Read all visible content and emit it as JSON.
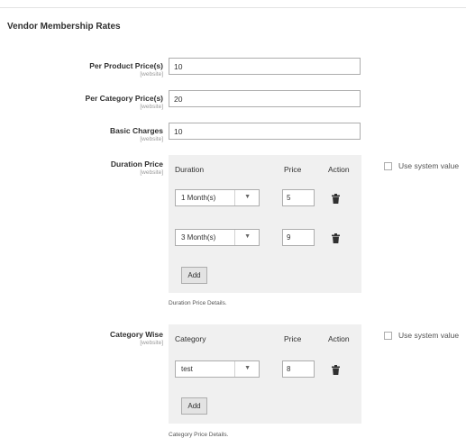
{
  "section_title": "Vendor Membership Rates",
  "scope_label": "[website]",
  "fields": {
    "per_product": {
      "label": "Per Product Price(s)",
      "value": "10"
    },
    "per_category": {
      "label": "Per Category Price(s)",
      "value": "20"
    },
    "basic_charges": {
      "label": "Basic Charges",
      "value": "10"
    }
  },
  "duration_price": {
    "label": "Duration Price",
    "headers": {
      "col1": "Duration",
      "col2": "Price",
      "col3": "Action"
    },
    "rows": [
      {
        "duration": "1 Month(s)",
        "price": "5"
      },
      {
        "duration": "3 Month(s)",
        "price": "9"
      }
    ],
    "add_label": "Add",
    "note": "Duration Price Details."
  },
  "category_wise": {
    "label": "Category Wise",
    "headers": {
      "col1": "Category",
      "col2": "Price",
      "col3": "Action"
    },
    "rows": [
      {
        "category": "test",
        "price": "8"
      }
    ],
    "add_label": "Add",
    "note": "Category Price Details."
  },
  "use_system_value": "Use system value",
  "icons": {
    "trash": "trash-icon",
    "dropdown": "chevron-down-icon",
    "checkbox": "checkbox-icon"
  }
}
